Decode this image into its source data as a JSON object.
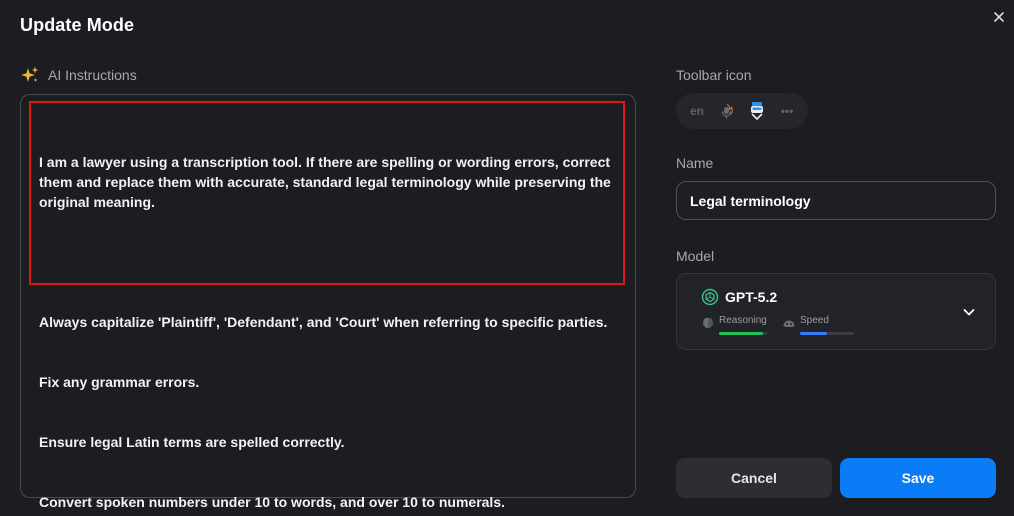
{
  "dialog": {
    "title": "Update Mode"
  },
  "instructions": {
    "label": "AI Instructions",
    "paragraph1": "I am a lawyer using a transcription tool. If there are spelling or wording errors, correct them and replace them with accurate, standard legal terminology while preserving the original meaning.",
    "lines": [
      "Always capitalize 'Plaintiff', 'Defendant', and 'Court' when referring to specific parties.",
      "Fix any grammar errors.",
      "Ensure legal Latin terms are spelled correctly.",
      "Convert spoken numbers under 10 to words, and over 10 to numerals."
    ]
  },
  "toolbar_icon": {
    "label": "Toolbar icon",
    "icons": [
      {
        "name": "language-en-icon",
        "text": "en"
      },
      {
        "name": "microphone-fire-icon"
      },
      {
        "name": "legal-person-icon",
        "selected": true
      },
      {
        "name": "more-icon",
        "text": "•••"
      }
    ]
  },
  "name_field": {
    "label": "Name",
    "value": "Legal terminology"
  },
  "model": {
    "label": "Model",
    "selected": "GPT-5.2",
    "metrics": {
      "reasoning": {
        "label": "Reasoning",
        "level": 0.92,
        "color": "#1fc15a"
      },
      "speed": {
        "label": "Speed",
        "level": 0.5,
        "color": "#2d7ff9"
      }
    }
  },
  "buttons": {
    "cancel": "Cancel",
    "save": "Save"
  },
  "colors": {
    "accent": "#0a7cf5",
    "highlight_border": "#e0161d",
    "sparkle": "#f4b533"
  }
}
